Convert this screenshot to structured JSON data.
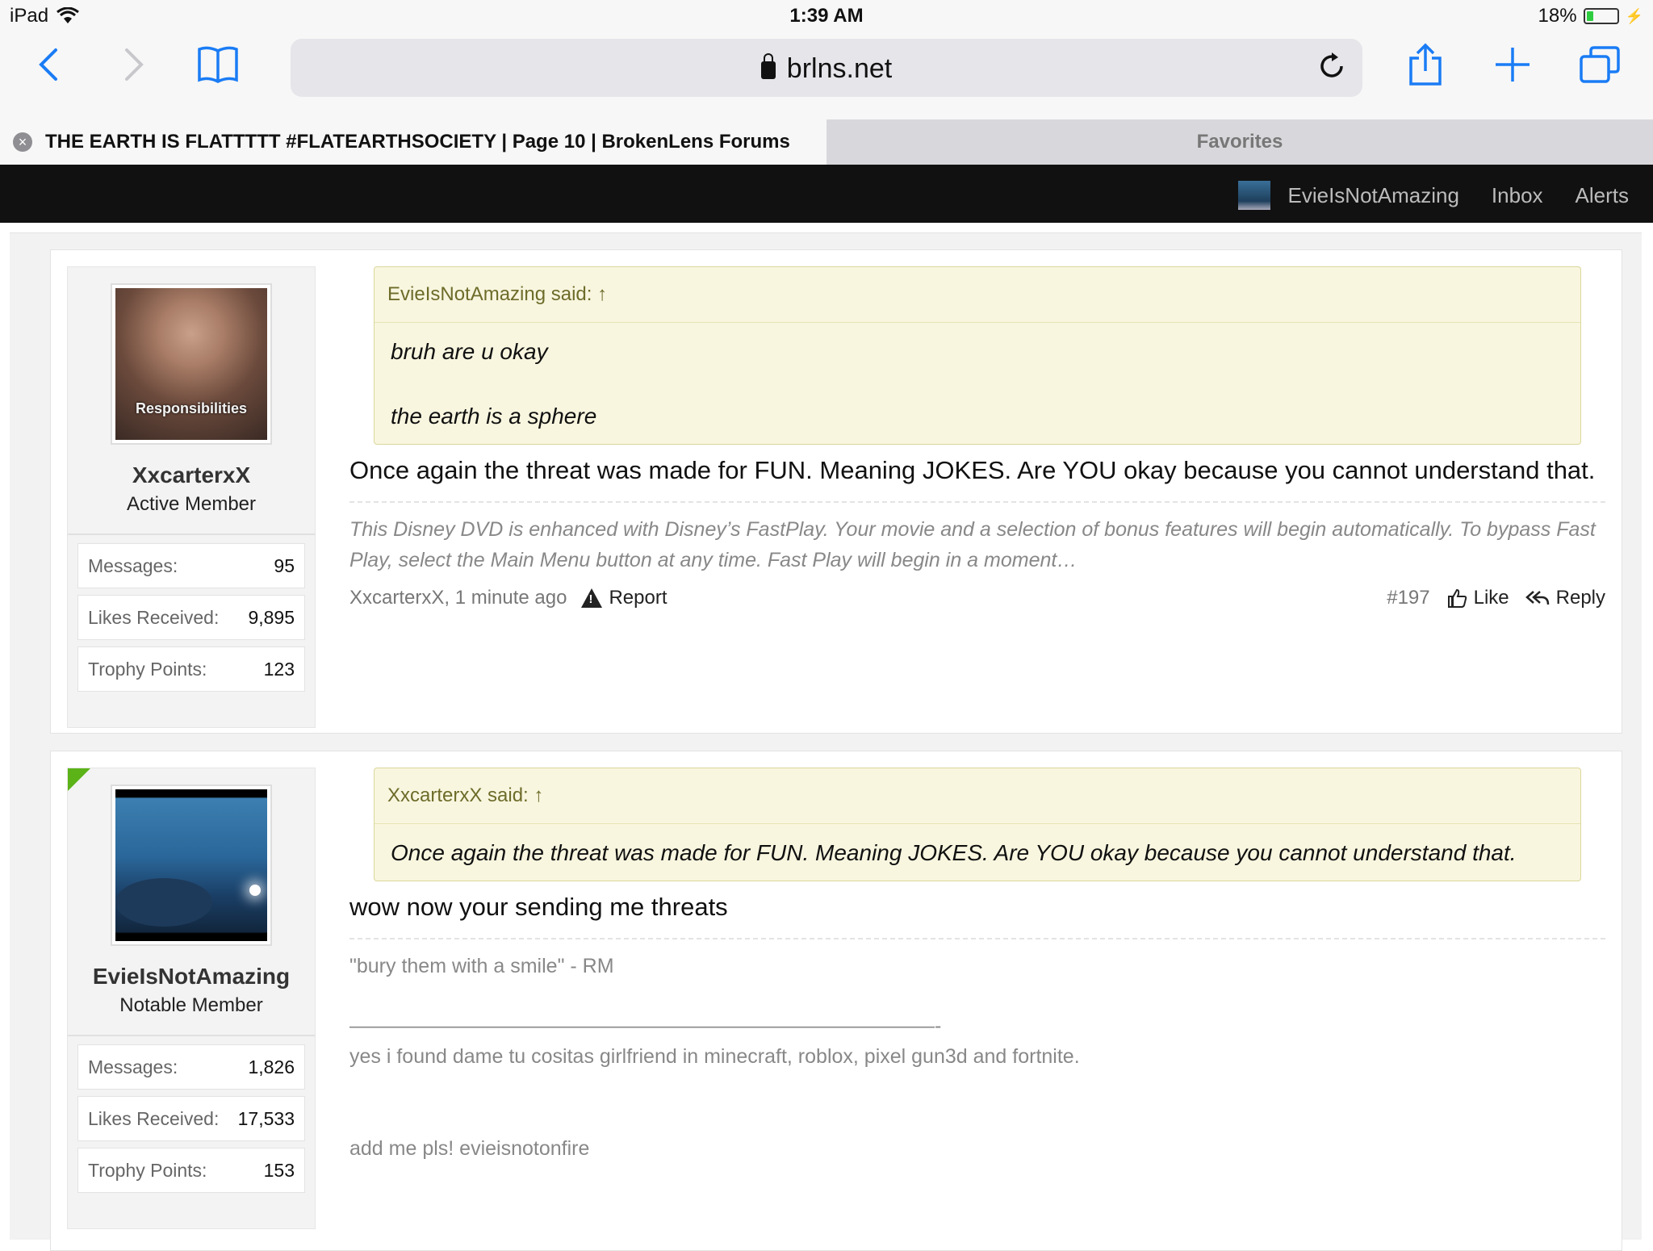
{
  "status_bar": {
    "device": "iPad",
    "time": "1:39 AM",
    "battery": "18%"
  },
  "browser": {
    "url": "brlns.net",
    "tab_title": "THE EARTH IS FLATTTTT #FLATEARTHSOCIETY | Page 10 | BrokenLens Forums",
    "favorites_label": "Favorites"
  },
  "site_nav": {
    "username": "EvieIsNotAmazing",
    "inbox": "Inbox",
    "alerts": "Alerts"
  },
  "posts": [
    {
      "author": "XxcarterxX",
      "user_title": "Active Member",
      "avatar_caption": "Responsibilities",
      "stats": [
        {
          "label": "Messages:",
          "value": "95"
        },
        {
          "label": "Likes Received:",
          "value": "9,895"
        },
        {
          "label": "Trophy Points:",
          "value": "123"
        }
      ],
      "quote_header": "EvieIsNotAmazing said: ↑",
      "quote_lines": [
        "bruh are u okay",
        "the earth is a sphere"
      ],
      "message": "Once again the threat was made for FUN. Meaning JOKES. Are YOU okay because you cannot understand that.",
      "signature": "This Disney DVD is enhanced with Disney’s FastPlay. Your movie and a selection of bonus features will begin automatically. To bypass Fast Play, select the Main Menu button at any time. Fast Play will begin in a moment…",
      "meta": "XxcarterxX, 1 minute ago",
      "report_label": "Report",
      "post_number": "#197",
      "like_label": "Like",
      "reply_label": "Reply"
    },
    {
      "author": "EvieIsNotAmazing",
      "user_title": "Notable Member",
      "stats": [
        {
          "label": "Messages:",
          "value": "1,826"
        },
        {
          "label": "Likes Received:",
          "value": "17,533"
        },
        {
          "label": "Trophy Points:",
          "value": "153"
        }
      ],
      "quote_header": "XxcarterxX said: ↑",
      "quote_lines": [
        "Once again the threat was made for FUN. Meaning JOKES. Are YOU okay because you cannot understand that."
      ],
      "message": "wow now your sending me threats",
      "signature_lines": [
        "\"bury them with a smile\" - RM",
        "—————————————————————————————-",
        "yes i found dame tu cositas girlfriend in minecraft, roblox, pixel gun3d and fortnite.",
        "add me pls! evieisnotonfire"
      ]
    }
  ]
}
